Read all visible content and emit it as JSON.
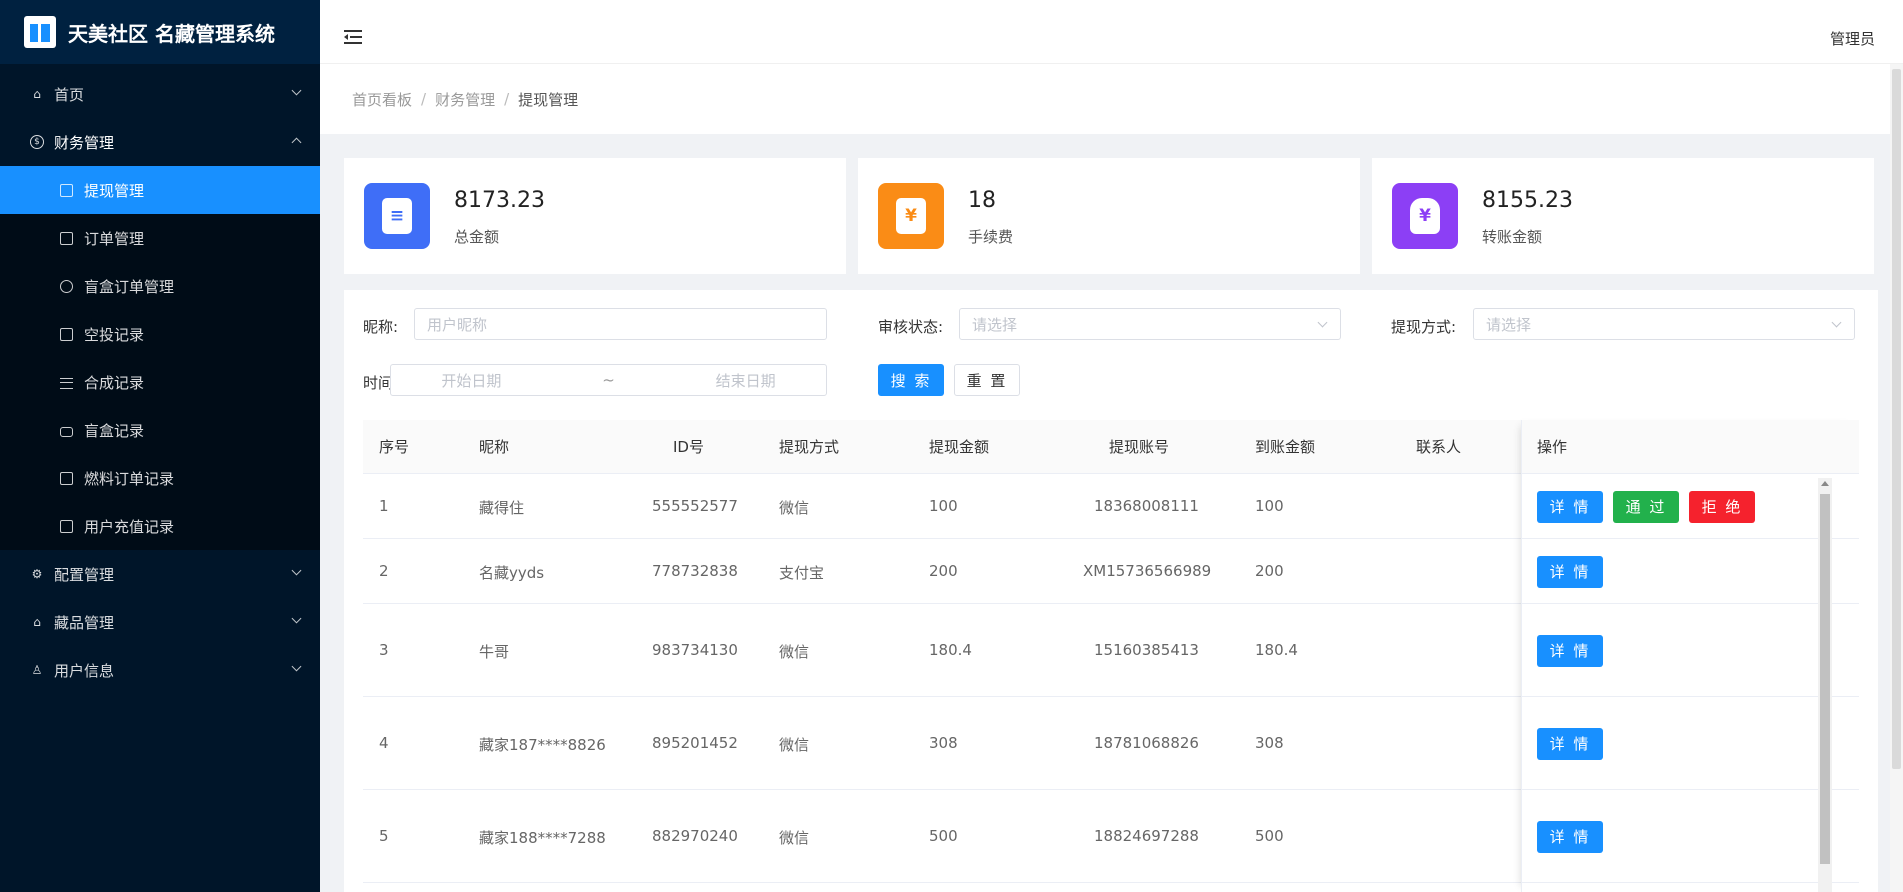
{
  "app": {
    "title": "天美社区 名藏管理系统"
  },
  "sidebar": {
    "items": [
      {
        "label": "首页",
        "icon": "home-icon"
      },
      {
        "label": "财务管理",
        "icon": "dollar-circle-icon",
        "open": true,
        "children": [
          {
            "label": "提现管理",
            "active": true
          },
          {
            "label": "订单管理"
          },
          {
            "label": "盲盒订单管理"
          },
          {
            "label": "空投记录"
          },
          {
            "label": "合成记录"
          },
          {
            "label": "盲盒记录"
          },
          {
            "label": "燃料订单记录"
          },
          {
            "label": "用户充值记录"
          }
        ]
      },
      {
        "label": "配置管理",
        "icon": "settings-icon"
      },
      {
        "label": "藏品管理",
        "icon": "bank-icon"
      },
      {
        "label": "用户信息",
        "icon": "user-icon"
      }
    ]
  },
  "header": {
    "user": "管理员"
  },
  "breadcrumb": [
    "首页看板",
    "财务管理",
    "提现管理"
  ],
  "stats": [
    {
      "value": "8173.23",
      "label": "总金额",
      "color": "#3f6ef7",
      "glyph": "≡"
    },
    {
      "value": "18",
      "label": "手续费",
      "color": "#fa8c16",
      "glyph": "¥"
    },
    {
      "value": "8155.23",
      "label": "转账金额",
      "color": "#8c3ff5",
      "glyph": "¥"
    }
  ],
  "filters": {
    "nickname_label": "昵称:",
    "nickname_placeholder": "用户昵称",
    "audit_label": "审核状态:",
    "audit_placeholder": "请选择",
    "method_label": "提现方式:",
    "method_placeholder": "请选择",
    "time_label": "时间",
    "start_placeholder": "开始日期",
    "range_sep": "~",
    "end_placeholder": "结束日期",
    "search_button": "搜 索",
    "reset_button": "重 置"
  },
  "table": {
    "columns": [
      "序号",
      "昵称",
      "ID号",
      "提现方式",
      "提现金额",
      "提现账号",
      "到账金额",
      "联系人",
      "操作"
    ],
    "rows": [
      {
        "no": "1",
        "nickname": "藏得住",
        "id": "555552577",
        "method": "微信",
        "amount": "100",
        "account": "18368008111",
        "received": "100",
        "contact": ""
      },
      {
        "no": "2",
        "nickname": "名藏yyds",
        "id": "778732838",
        "method": "支付宝",
        "amount": "200",
        "account": "XM15736566989",
        "received": "200",
        "contact": ""
      },
      {
        "no": "3",
        "nickname": "牛哥",
        "id": "983734130",
        "method": "微信",
        "amount": "180.4",
        "account": "15160385413",
        "received": "180.4",
        "contact": ""
      },
      {
        "no": "4",
        "nickname": "藏家187****8826",
        "id": "895201452",
        "method": "微信",
        "amount": "308",
        "account": "18781068826",
        "received": "308",
        "contact": ""
      },
      {
        "no": "5",
        "nickname": "藏家188****7288",
        "id": "882970240",
        "method": "微信",
        "amount": "500",
        "account": "18824697288",
        "received": "500",
        "contact": ""
      }
    ],
    "actions": {
      "detail": "详 情",
      "pass": "通 过",
      "reject": "拒 绝"
    }
  }
}
